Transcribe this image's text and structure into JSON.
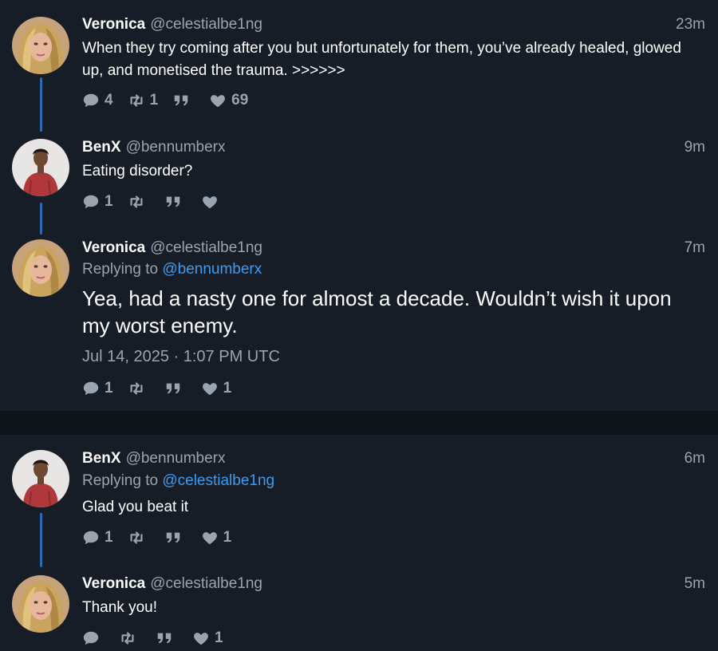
{
  "tweets": [
    {
      "name": "Veronica",
      "handle": "@celestialbe1ng",
      "time": "23m",
      "text": "When they try coming after you but unfortunately for them, you’ve already healed, glowed up, and monetised the trauma. >>>>>>",
      "stats": {
        "replies": "4",
        "retweets": "1",
        "quotes": "",
        "likes": "69"
      }
    },
    {
      "name": "BenX",
      "handle": "@bennumberx",
      "time": "9m",
      "text": "Eating disorder?",
      "stats": {
        "replies": "1",
        "retweets": "",
        "quotes": "",
        "likes": ""
      }
    },
    {
      "name": "Veronica",
      "handle": "@celestialbe1ng",
      "time": "7m",
      "reply_prefix": "Replying to",
      "reply_to": "@bennumberx",
      "text": "Yea, had a nasty one for almost a decade. Wouldn’t wish it upon my worst enemy.",
      "date": "Jul 14, 2025 · 1:07 PM UTC",
      "stats": {
        "replies": "1",
        "retweets": "",
        "quotes": "",
        "likes": "1"
      }
    },
    {
      "name": "BenX",
      "handle": "@bennumberx",
      "time": "6m",
      "reply_prefix": "Replying to",
      "reply_to": "@celestialbe1ng",
      "text": "Glad you beat it",
      "stats": {
        "replies": "1",
        "retweets": "",
        "quotes": "",
        "likes": "1"
      }
    },
    {
      "name": "Veronica",
      "handle": "@celestialbe1ng",
      "time": "5m",
      "text": "Thank you!",
      "stats": {
        "replies": "",
        "retweets": "",
        "quotes": "",
        "likes": "1"
      }
    }
  ],
  "icons": [
    "comment-icon",
    "retweet-icon",
    "quote-icon",
    "heart-icon"
  ],
  "colors": {
    "background": "#161d27",
    "separator": "#0f141b",
    "thread_line": "#2a6bb3",
    "link": "#3c9cf0",
    "muted": "#9aa4b0"
  }
}
